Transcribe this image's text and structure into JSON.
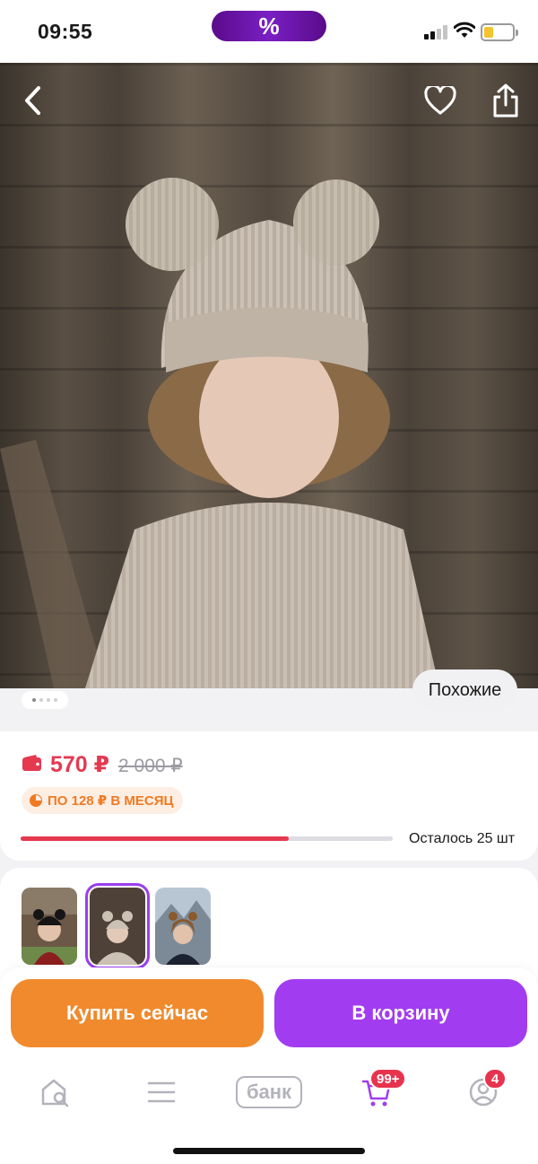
{
  "status_bar": {
    "time": "09:55",
    "promo_symbol": "%"
  },
  "gallery": {
    "page_count": 4,
    "active_index": 0,
    "similar_label": "Похожие"
  },
  "price": {
    "current": "570 ₽",
    "old": "2 000 ₽",
    "installment": "ПО 128 ₽ В МЕСЯЦ",
    "stock_text": "Осталось 25 шт",
    "stock_fill_fraction": 0.72
  },
  "variants": [
    {
      "name": "black-hat",
      "selected": false
    },
    {
      "name": "beige-hat",
      "selected": true
    },
    {
      "name": "brown-hat",
      "selected": false
    }
  ],
  "actions": {
    "buy_now_label": "Купить сейчас",
    "cart_label": "В корзину"
  },
  "bottom_nav": {
    "items": [
      {
        "name": "home-search",
        "icon": "home-search-icon"
      },
      {
        "name": "catalog",
        "icon": "menu-icon"
      },
      {
        "name": "bank",
        "label": "банк"
      },
      {
        "name": "cart",
        "icon": "cart-icon",
        "badge": "99+"
      },
      {
        "name": "profile",
        "icon": "profile-icon",
        "badge": "4"
      }
    ]
  },
  "colors": {
    "accent_purple": "#a23cf0",
    "accent_orange": "#f08a2c",
    "price_red": "#e53950"
  }
}
